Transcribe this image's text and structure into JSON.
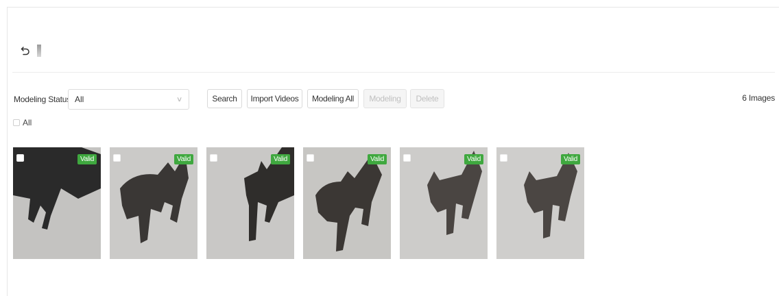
{
  "header": {
    "back_icon": "undo-arrow-icon"
  },
  "filter": {
    "label": "Modeling Status",
    "select_value": "All",
    "select_icon": "chevron-down-icon"
  },
  "toolbar": {
    "search_label": "Search",
    "import_label": "Import Videos",
    "modeling_all_label": "Modeling All",
    "modeling_label": "Modeling",
    "delete_label": "Delete"
  },
  "image_count": "6 Images",
  "select_all_label": "All",
  "images": [
    {
      "status": "Valid"
    },
    {
      "status": "Valid"
    },
    {
      "status": "Valid"
    },
    {
      "status": "Valid"
    },
    {
      "status": "Valid"
    },
    {
      "status": "Valid"
    }
  ],
  "colors": {
    "valid_badge": "#3fa83f",
    "accent": "#3fa83f"
  }
}
